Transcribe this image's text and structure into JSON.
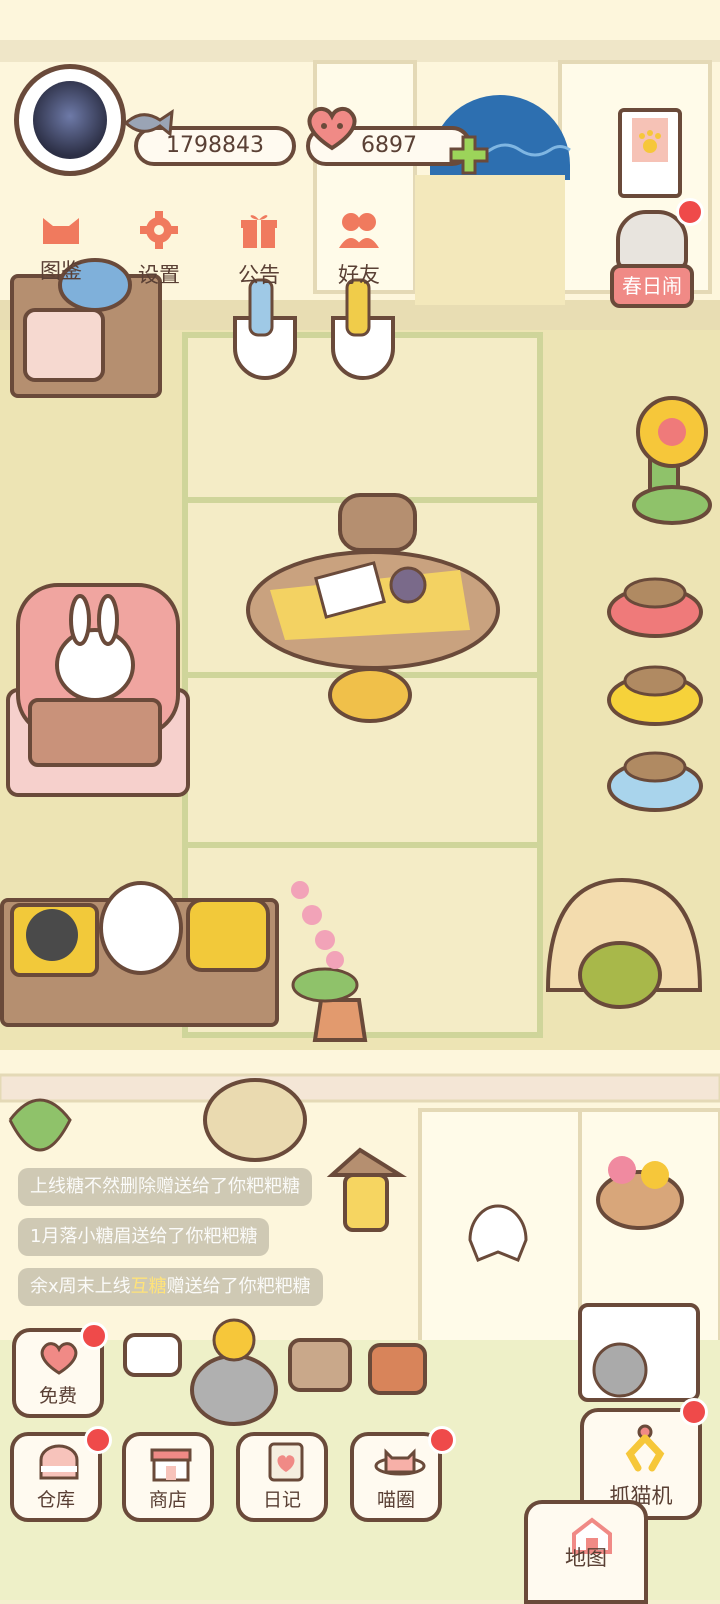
{
  "hud": {
    "fish_currency": "1798843",
    "heart_currency": "6897"
  },
  "top_menu": [
    {
      "label": "图鉴"
    },
    {
      "label": "设置"
    },
    {
      "label": "公告"
    },
    {
      "label": "好友"
    }
  ],
  "event": {
    "label": "春日闹"
  },
  "messages": [
    {
      "pre": "上线",
      "hl": "",
      "text": "糖不然删除赠送给了你粑粑糖"
    },
    {
      "pre": "1月落小",
      "hl": "",
      "text": "糖眉送给了你粑粑糖"
    },
    {
      "pre": "余x周末上线",
      "hl": "互糖",
      "text": "赠送给了你粑粑糖"
    }
  ],
  "bottom_menu": {
    "free": "免费",
    "warehouse": "仓库",
    "shop": "商店",
    "diary": "日记",
    "cat_circle": "喵圈",
    "claw": "抓猫机",
    "map": "地图"
  },
  "colors": {
    "accent_red": "#ef4a4a",
    "outline_brown": "#6a4a3a",
    "floor": "#ede4b4",
    "wall": "#fdf6dc"
  }
}
